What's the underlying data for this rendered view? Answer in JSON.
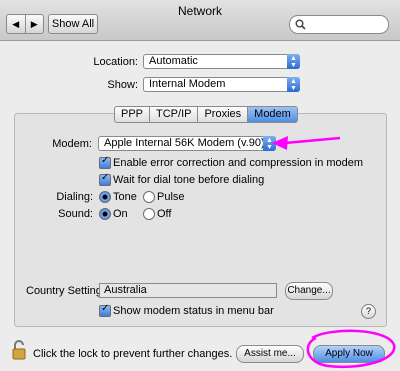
{
  "window": {
    "title": "Network"
  },
  "toolbar": {
    "back": "◀",
    "forward": "▶",
    "show_all": "Show All",
    "search_placeholder": ""
  },
  "location": {
    "label": "Location:",
    "value": "Automatic"
  },
  "show": {
    "label": "Show:",
    "value": "Internal Modem"
  },
  "tabs": [
    {
      "label": "PPP",
      "active": false
    },
    {
      "label": "TCP/IP",
      "active": false
    },
    {
      "label": "Proxies",
      "active": false
    },
    {
      "label": "Modem",
      "active": true
    }
  ],
  "modem": {
    "label": "Modem:",
    "value": "Apple Internal 56K Modem (v.90)",
    "error_correction": "Enable error correction and compression in modem",
    "wait_dial_tone": "Wait for dial tone before dialing",
    "dialing_label": "Dialing:",
    "dialing_tone": "Tone",
    "dialing_pulse": "Pulse",
    "sound_label": "Sound:",
    "sound_on": "On",
    "sound_off": "Off"
  },
  "country": {
    "label": "Country Setting:",
    "value": "Australia",
    "change_button": "Change..."
  },
  "status_menu": "Show modem status in menu bar",
  "help": "?",
  "footer": {
    "lock_text": "Click the lock to prevent further changes.",
    "assist_button": "Assist me...",
    "apply_button": "Apply Now"
  },
  "colors": {
    "annotation": "#ff00ff",
    "accent": "#3d7ddc"
  }
}
